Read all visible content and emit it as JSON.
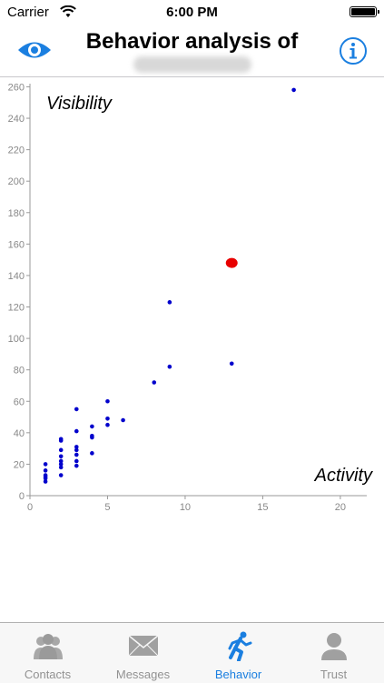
{
  "status_bar": {
    "carrier": "Carrier",
    "time": "6:00 PM"
  },
  "navbar": {
    "title": "Behavior analysis of",
    "left_icon": "eye-icon",
    "right_icon": "info-icon",
    "accent_color": "#1b7fe0"
  },
  "chart_data": {
    "type": "scatter",
    "title": "",
    "xlabel": "Activity",
    "ylabel": "Visibility",
    "xlim": [
      0,
      21
    ],
    "ylim": [
      0,
      262
    ],
    "xticks": [
      0,
      5,
      10,
      15,
      20
    ],
    "yticks": [
      0,
      20,
      40,
      60,
      80,
      100,
      120,
      140,
      160,
      180,
      200,
      220,
      240,
      260
    ],
    "grid": false,
    "points": [
      {
        "x": 1,
        "y": 9
      },
      {
        "x": 1,
        "y": 11
      },
      {
        "x": 1,
        "y": 12
      },
      {
        "x": 1,
        "y": 13
      },
      {
        "x": 1,
        "y": 16
      },
      {
        "x": 1,
        "y": 20
      },
      {
        "x": 2,
        "y": 13
      },
      {
        "x": 2,
        "y": 18
      },
      {
        "x": 2,
        "y": 20
      },
      {
        "x": 2,
        "y": 22
      },
      {
        "x": 2,
        "y": 25
      },
      {
        "x": 2,
        "y": 29
      },
      {
        "x": 2,
        "y": 35
      },
      {
        "x": 2,
        "y": 36
      },
      {
        "x": 3,
        "y": 19
      },
      {
        "x": 3,
        "y": 22
      },
      {
        "x": 3,
        "y": 26
      },
      {
        "x": 3,
        "y": 29
      },
      {
        "x": 3,
        "y": 31
      },
      {
        "x": 3,
        "y": 41
      },
      {
        "x": 3,
        "y": 55
      },
      {
        "x": 4,
        "y": 27
      },
      {
        "x": 4,
        "y": 37
      },
      {
        "x": 4,
        "y": 38
      },
      {
        "x": 4,
        "y": 44
      },
      {
        "x": 5,
        "y": 45
      },
      {
        "x": 5,
        "y": 49
      },
      {
        "x": 5,
        "y": 60
      },
      {
        "x": 6,
        "y": 48
      },
      {
        "x": 8,
        "y": 72
      },
      {
        "x": 9,
        "y": 82
      },
      {
        "x": 9,
        "y": 123
      },
      {
        "x": 13,
        "y": 84
      },
      {
        "x": 17,
        "y": 258
      }
    ],
    "highlight": {
      "x": 13,
      "y": 148
    },
    "point_color": "#0000cc",
    "highlight_color": "#e80000"
  },
  "tabbar": {
    "tabs": [
      {
        "label": "Contacts",
        "icon": "contacts-icon",
        "active": false
      },
      {
        "label": "Messages",
        "icon": "messages-icon",
        "active": false
      },
      {
        "label": "Behavior",
        "icon": "running-man-icon",
        "active": true
      },
      {
        "label": "Trust",
        "icon": "person-icon",
        "active": false
      }
    ],
    "active_color": "#1b7fe0",
    "inactive_color": "#929292"
  }
}
